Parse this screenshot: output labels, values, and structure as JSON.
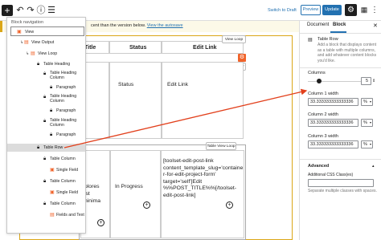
{
  "toolbar": {
    "switch_to_draft": "Switch to Draft",
    "preview": "Preview",
    "update": "Update",
    "icons": [
      "add-icon",
      "undo-icon",
      "redo-icon",
      "info-icon",
      "list-view-icon",
      "gear-icon",
      "calendar-icon",
      "more-icon"
    ]
  },
  "notice": {
    "prefix": "Th",
    "text": "cent than the version below.",
    "link": "View the autosave"
  },
  "block_nav": {
    "title": "Block navigation",
    "items": [
      {
        "label": "View",
        "icon": "view-icon"
      },
      {
        "label": "View Output",
        "icon": "view-output-icon"
      },
      {
        "label": "View Loop",
        "icon": "loop-icon"
      },
      {
        "label": "Table Heading",
        "icon": "lock-icon"
      },
      {
        "label": "Table Heading Column",
        "icon": "lock-icon"
      },
      {
        "label": "Paragraph",
        "icon": "lock-icon"
      },
      {
        "label": "Table Heading Column",
        "icon": "lock-icon"
      },
      {
        "label": "Paragraph",
        "icon": "lock-icon"
      },
      {
        "label": "Table Heading Column",
        "icon": "lock-icon"
      },
      {
        "label": "Paragraph",
        "icon": "lock-icon"
      },
      {
        "label": "Table Row",
        "icon": "lock-icon"
      },
      {
        "label": "Table Column",
        "icon": "lock-icon"
      },
      {
        "label": "Single Field",
        "icon": "field-icon"
      },
      {
        "label": "Table Column",
        "icon": "lock-icon"
      },
      {
        "label": "Single Field",
        "icon": "field-icon"
      },
      {
        "label": "Table Column",
        "icon": "lock-icon"
      },
      {
        "label": "Fields and Text",
        "icon": "fields-text-icon"
      }
    ]
  },
  "canvas": {
    "header_title": "Title",
    "header_status": "Status",
    "header_edit": "Edit Link",
    "pill_view_loop": "View Loop",
    "pill_table_header": "Table header",
    "pill_table_view_loop": "Table View Loop",
    "row1_status": "Status",
    "row1_edit": "Edit Link",
    "row2_shortcode": "[toolset-edit-post-link content_template_slug='container-for-edit-project-form' target='self']Edit %%POST_TITLE%%[/toolset-edit-post-link]",
    "row2_status": "In Progress",
    "row2_title_frag": "olores\nist\nninima"
  },
  "sidebar": {
    "tab_document": "Document",
    "tab_block": "Block",
    "block_name": "Table Row",
    "block_desc": "Add a block that displays content as a table with multiple columns, and add whatever content blocks you'd like.",
    "columns_label": "Columns",
    "columns_value": "5",
    "columns_fill_fraction": 0.2,
    "col1_label": "Column 1 width",
    "col1_value": "33.333333333333336",
    "col2_label": "Column 2 width",
    "col2_value": "33.333333333333336",
    "col3_label": "Column 3 width",
    "col3_value": "33.333333333333336",
    "unit": "%",
    "advanced_label": "Advanced",
    "css_label": "Additional CSS Class(es)",
    "css_help": "Separate multiple classes with spaces."
  }
}
